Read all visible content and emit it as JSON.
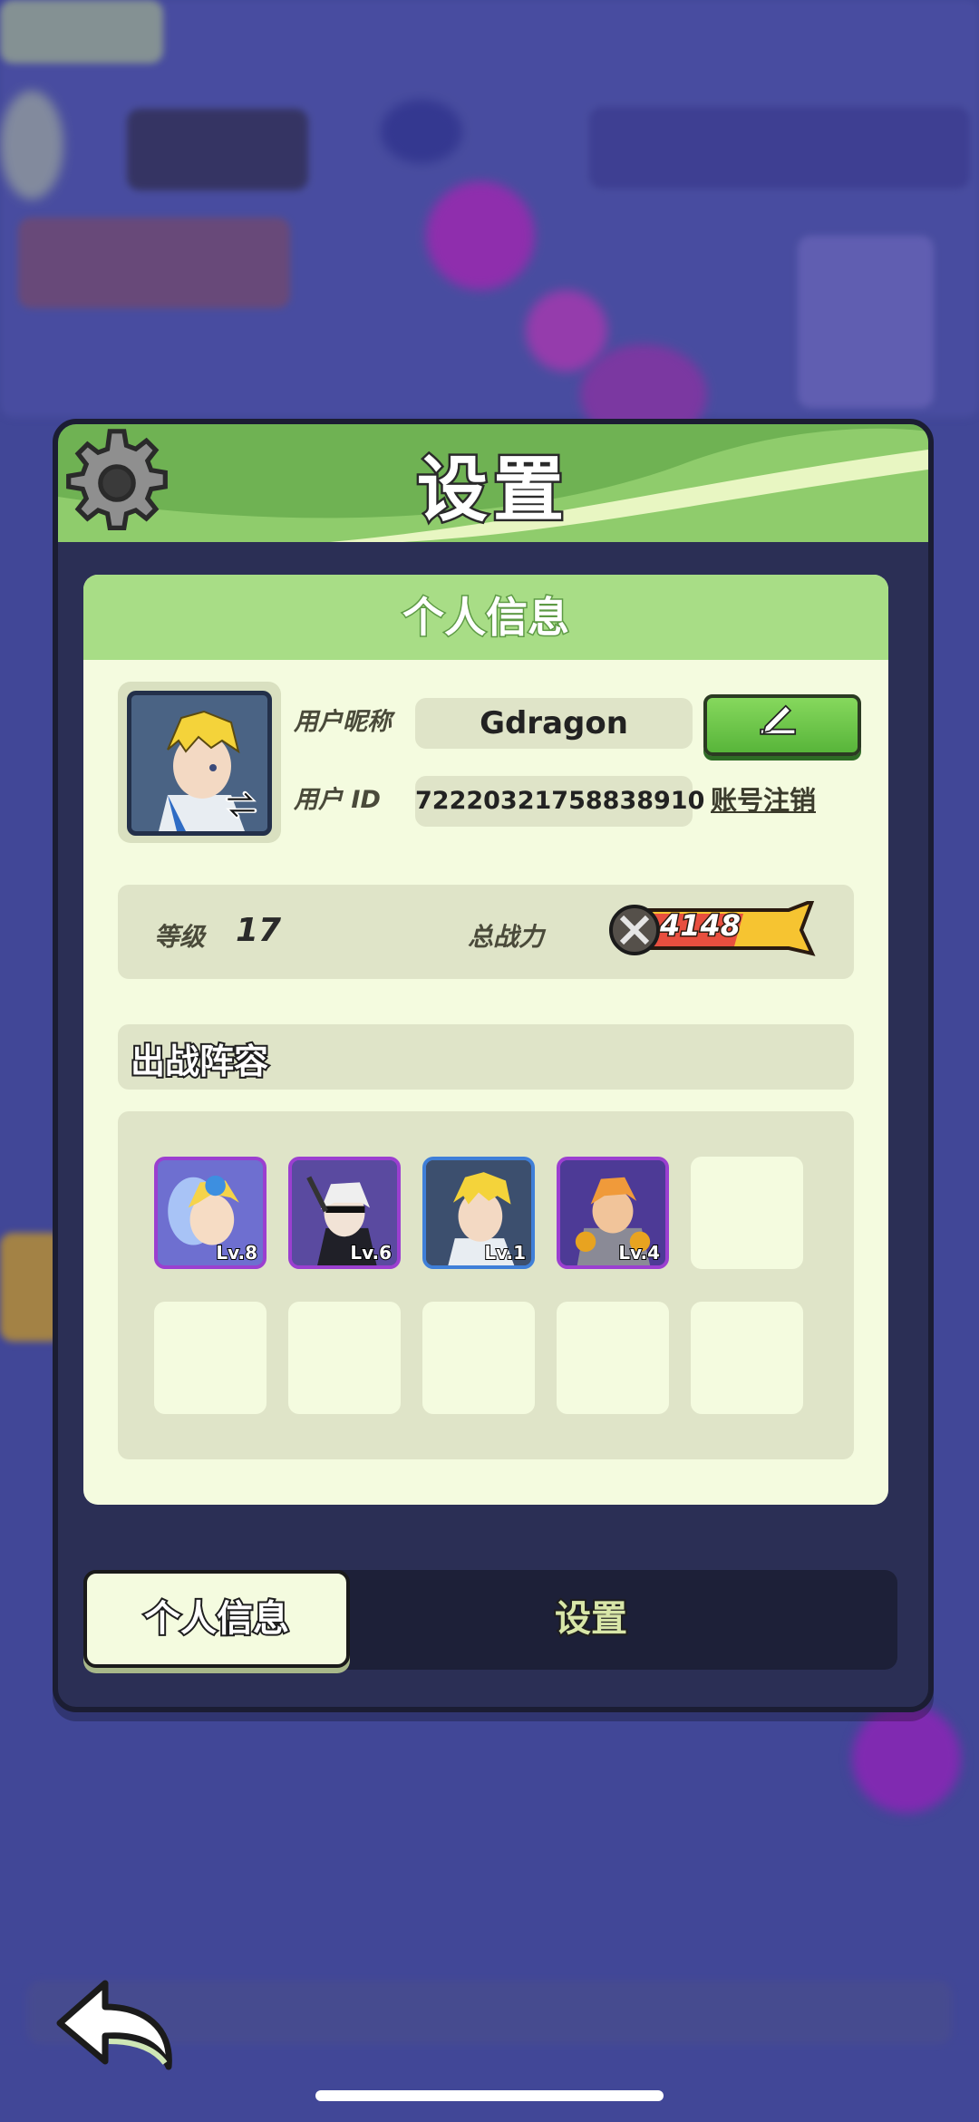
{
  "title": "设置",
  "profile": {
    "section_title": "个人信息",
    "nickname_label": "用户昵称",
    "nickname": "Gdragon",
    "user_id_label": "用户 ID",
    "user_id": "72220321758838910",
    "cancel_account": "账号注销"
  },
  "stats": {
    "level_label": "等级",
    "level": "17",
    "power_label": "总战力",
    "power": "4148"
  },
  "lineup": {
    "title": "出战阵容",
    "heroes": [
      {
        "level": "Lv.8",
        "rarity_color": "#a24ed8"
      },
      {
        "level": "Lv.6",
        "rarity_color": "#a24ed8"
      },
      {
        "level": "Lv.1",
        "rarity_color": "#3f7fd8"
      },
      {
        "level": "Lv.4",
        "rarity_color": "#a24ed8"
      }
    ],
    "empty_slots": 6
  },
  "tabs": {
    "active": "个人信息",
    "inactive": "设置"
  },
  "icons": {
    "gear": "gear-icon",
    "edit": "pencil-icon",
    "swap": "swap-icon",
    "back": "back-arrow-icon",
    "power": "crossed-swords-icon"
  },
  "colors": {
    "header_green": "#6fb253",
    "card_bg": "#f4fbdf",
    "accent_green": "#58b53a",
    "panel_dark": "#2b2f55"
  }
}
